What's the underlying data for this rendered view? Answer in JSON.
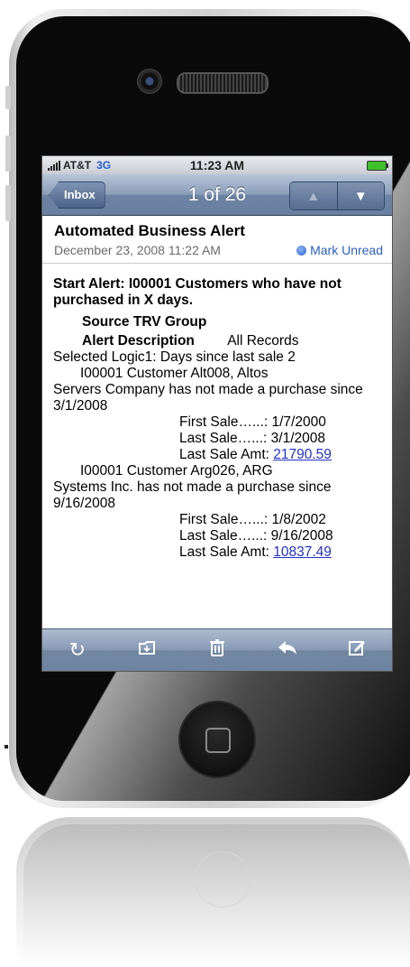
{
  "status": {
    "carrier": "AT&T",
    "network": "3G",
    "time": "11:23 AM"
  },
  "nav": {
    "back_label": "Inbox",
    "title": "1 of 26",
    "up_icon": "▲",
    "down_icon": "▼"
  },
  "mail": {
    "subject": "Automated Business Alert",
    "date": "December 23, 2008 11:22 AM",
    "mark_unread": "Mark Unread"
  },
  "body": {
    "line1": "Start Alert:     I00001     Customers who have not purchased in X days.",
    "line2": "Source  TRV Group",
    "line3_bold": "Alert    Description",
    "line3_rest": "All Records",
    "line4": "Selected   Logic1: Days since last sale 2",
    "rec1_intro": "I00001     Customer Alt008,  Altos",
    "rec1_rest": "Servers Company has not made a purchase since 3/1/2008",
    "rec1_first": "First Sale…...: 1/7/2000",
    "rec1_last": "Last Sale…...: 3/1/2008",
    "rec1_amt_label": "Last Sale Amt: ",
    "rec1_amt": "21790.59",
    "rec2_intro": "I00001     Customer Arg026,  ARG",
    "rec2_rest": "Systems Inc. has not made a purchase since 9/16/2008",
    "rec2_first": "First Sale…...: 1/8/2002",
    "rec2_last": "Last Sale…...: 9/16/2008",
    "rec2_amt_label": "Last Sale Amt: ",
    "rec2_amt": "10837.49"
  },
  "toolbar": {
    "refresh_icon": "refresh-icon",
    "folder_icon": "move-to-folder-icon",
    "trash_icon": "trash-icon",
    "reply_icon": "reply-icon",
    "compose_icon": "compose-icon"
  },
  "colors": {
    "nav_blue": "#6d83a4",
    "link": "#2431c7",
    "mark_unread": "#2a5fc0",
    "battery": "#3fbf2a"
  }
}
